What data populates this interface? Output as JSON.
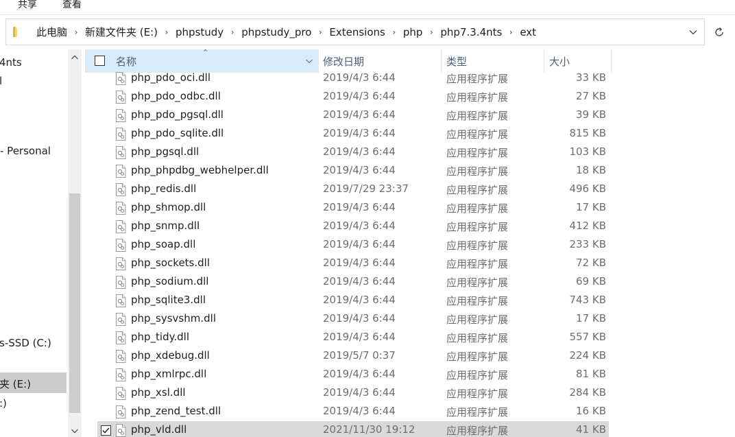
{
  "ribbon": {
    "tabs": [
      "共享",
      "查看"
    ]
  },
  "address": {
    "crumbs": [
      "此电脑",
      "新建文件夹 (E:)",
      "phpstudy",
      "phpstudy_pro",
      "Extensions",
      "php",
      "php7.3.4nts",
      "ext"
    ]
  },
  "nav": {
    "items": [
      {
        "label": "4nts",
        "selected": false
      },
      {
        "label": "l",
        "selected": false
      },
      {
        "label": "- Personal",
        "selected": false
      },
      {
        "label": "s-SSD (C:)",
        "selected": false
      },
      {
        "label": "夹 (E:)",
        "selected": true
      },
      {
        "label": ":)",
        "selected": false
      }
    ]
  },
  "columns": {
    "name": "名称",
    "date": "修改日期",
    "type": "类型",
    "size": "大小"
  },
  "files": [
    {
      "name": "php_pdo_oci.dll",
      "date": "2019/4/3 6:44",
      "type": "应用程序扩展",
      "size": "33 KB",
      "selected": false
    },
    {
      "name": "php_pdo_odbc.dll",
      "date": "2019/4/3 6:44",
      "type": "应用程序扩展",
      "size": "27 KB",
      "selected": false
    },
    {
      "name": "php_pdo_pgsql.dll",
      "date": "2019/4/3 6:44",
      "type": "应用程序扩展",
      "size": "39 KB",
      "selected": false
    },
    {
      "name": "php_pdo_sqlite.dll",
      "date": "2019/4/3 6:44",
      "type": "应用程序扩展",
      "size": "815 KB",
      "selected": false
    },
    {
      "name": "php_pgsql.dll",
      "date": "2019/4/3 6:44",
      "type": "应用程序扩展",
      "size": "103 KB",
      "selected": false
    },
    {
      "name": "php_phpdbg_webhelper.dll",
      "date": "2019/4/3 6:44",
      "type": "应用程序扩展",
      "size": "18 KB",
      "selected": false
    },
    {
      "name": "php_redis.dll",
      "date": "2019/7/29 23:37",
      "type": "应用程序扩展",
      "size": "496 KB",
      "selected": false
    },
    {
      "name": "php_shmop.dll",
      "date": "2019/4/3 6:44",
      "type": "应用程序扩展",
      "size": "17 KB",
      "selected": false
    },
    {
      "name": "php_snmp.dll",
      "date": "2019/4/3 6:44",
      "type": "应用程序扩展",
      "size": "412 KB",
      "selected": false
    },
    {
      "name": "php_soap.dll",
      "date": "2019/4/3 6:44",
      "type": "应用程序扩展",
      "size": "233 KB",
      "selected": false
    },
    {
      "name": "php_sockets.dll",
      "date": "2019/4/3 6:44",
      "type": "应用程序扩展",
      "size": "72 KB",
      "selected": false
    },
    {
      "name": "php_sodium.dll",
      "date": "2019/4/3 6:44",
      "type": "应用程序扩展",
      "size": "69 KB",
      "selected": false
    },
    {
      "name": "php_sqlite3.dll",
      "date": "2019/4/3 6:44",
      "type": "应用程序扩展",
      "size": "743 KB",
      "selected": false
    },
    {
      "name": "php_sysvshm.dll",
      "date": "2019/4/3 6:44",
      "type": "应用程序扩展",
      "size": "17 KB",
      "selected": false
    },
    {
      "name": "php_tidy.dll",
      "date": "2019/4/3 6:44",
      "type": "应用程序扩展",
      "size": "557 KB",
      "selected": false
    },
    {
      "name": "php_xdebug.dll",
      "date": "2019/5/7 0:37",
      "type": "应用程序扩展",
      "size": "224 KB",
      "selected": false
    },
    {
      "name": "php_xmlrpc.dll",
      "date": "2019/4/3 6:44",
      "type": "应用程序扩展",
      "size": "81 KB",
      "selected": false
    },
    {
      "name": "php_xsl.dll",
      "date": "2019/4/3 6:44",
      "type": "应用程序扩展",
      "size": "284 KB",
      "selected": false
    },
    {
      "name": "php_zend_test.dll",
      "date": "2019/4/3 6:44",
      "type": "应用程序扩展",
      "size": "16 KB",
      "selected": false
    },
    {
      "name": "php_vld.dll",
      "date": "2021/11/30 19:12",
      "type": "应用程序扩展",
      "size": "41 KB",
      "selected": true
    }
  ],
  "icons": {
    "folder": "folder-icon",
    "file": "dll-file-icon",
    "refresh": "refresh-icon",
    "dropdown": "chevron-down-icon",
    "scroll_up": "chevron-up-icon",
    "scroll_down": "chevron-down-icon"
  }
}
